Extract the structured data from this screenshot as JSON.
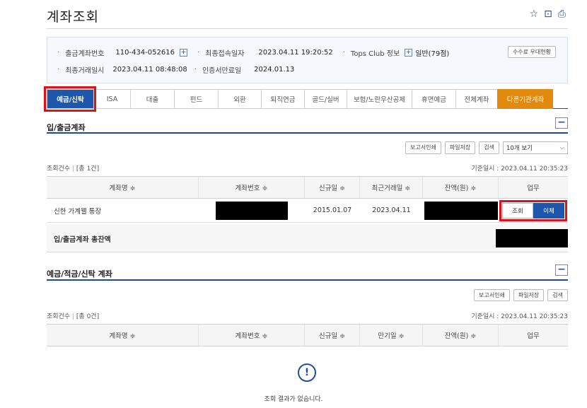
{
  "page": {
    "title": "계좌조회"
  },
  "header_icons": [
    "star-icon",
    "save-icon",
    "print-icon"
  ],
  "info": {
    "row1": {
      "acct_label": "출금계좌번호",
      "acct_value": "110-434-052616",
      "last_access_label": "최종접속일자",
      "last_access_value": "2023.04.11 19:20:52",
      "tops_label": "Tops Club 정보",
      "tops_value": "일반(79점)",
      "fee_button": "수수료 우대현황"
    },
    "row2": {
      "last_tx_label": "최종거래일시",
      "last_tx_value": "2023.04.11 08:48:08",
      "cert_label": "인증서만료일",
      "cert_value": "2024.01.13"
    }
  },
  "tabs": [
    "예금/신탁",
    "ISA",
    "대출",
    "펀드",
    "외환",
    "퇴직연금",
    "골드/실버",
    "보험/노란우산공제",
    "휴면예금",
    "전체계좌",
    "다른기관계좌"
  ],
  "section1": {
    "title": "입/출금계좌",
    "tools": {
      "print": "보고서인쇄",
      "save": "파일저장",
      "search": "검색",
      "view": "10개 보기"
    },
    "count_label": "조회건수",
    "count_value": "[총 1건]",
    "ref_time": "기준일시 : 2023.04.11 20:35:23",
    "columns": [
      "계좌명 ≑",
      "계좌번호 ≑",
      "신규일 ≑",
      "최근거래일 ≑",
      "잔액(원) ≑",
      "업무"
    ],
    "rows": [
      {
        "name": "신한 가계웰 통장",
        "new_date": "2015.01.07",
        "last_tx": "2023.04.11",
        "btn_view": "조회",
        "btn_transfer": "이체"
      }
    ],
    "total_label": "입/출금계좌 총잔액"
  },
  "section2": {
    "title": "예금/적금/신탁 계좌",
    "tools": {
      "print": "보고서인쇄",
      "save": "파일저장",
      "search": "검색"
    },
    "count_label": "조회건수",
    "count_value": "[총 0건]",
    "ref_time": "기준일시 : 2023.04.11 20:35:23",
    "columns": [
      "계좌명 ≑",
      "계좌번호 ≑",
      "신규일 ≑",
      "만기일 ≑",
      "잔액(원) ≑",
      "업무"
    ],
    "empty_message": "조회 결과가 없습니다."
  },
  "colors": {
    "primary": "#1c57ad",
    "orange": "#e28a0d",
    "highlight": "#e0101a"
  }
}
